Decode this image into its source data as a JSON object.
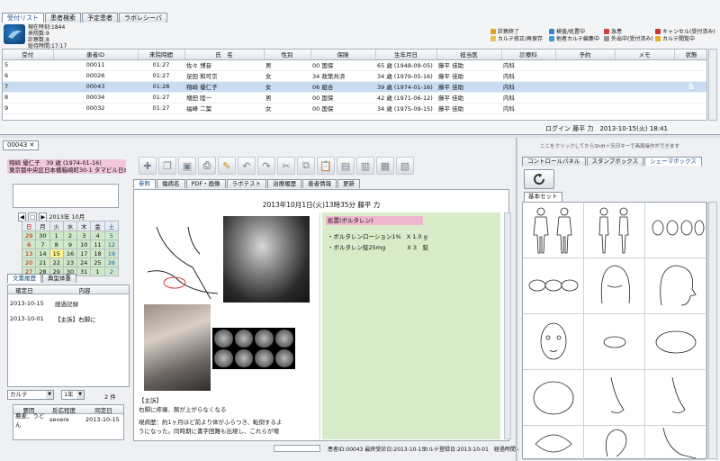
{
  "top_tabs": [
    "受付リスト",
    "患者検索",
    "予定患者",
    "ラボレシーバ"
  ],
  "counts": [
    "現在時刻:1844",
    "来院数:9",
    "診察数:8",
    "総待時間:17:17"
  ],
  "legend": [
    {
      "label": "診察終了",
      "color": "#e0a030"
    },
    {
      "label": "カルテ修正/再保存",
      "color": "#e8c24a"
    },
    {
      "label": "検査/処置中",
      "color": "#3f7fd0"
    },
    {
      "label": "他者カルテ編集中",
      "color": "#3fa0d8"
    },
    {
      "label": "急患",
      "color": "#d04040"
    },
    {
      "label": "外出中(受付済み)",
      "color": "#999999"
    },
    {
      "label": "キャンセル(受付済み)",
      "color": "#cc3333"
    },
    {
      "label": "カルテ閲覧中",
      "color": "#e6b030"
    }
  ],
  "reception_table": {
    "columns": [
      "受付",
      "患者ID",
      "来院時間",
      "氏　名",
      "性別",
      "保険",
      "生年月日",
      "担当医",
      "診療科",
      "予約",
      "メモ",
      "状態"
    ],
    "rows": [
      [
        "5",
        "00011",
        "01:27",
        "佐々 博音",
        "男",
        "00 国保",
        "65 歳 (1948-09-05)",
        "藤平 佳助",
        "内科",
        "",
        "",
        ""
      ],
      [
        "6",
        "00026",
        "01:27",
        "足田 和可京",
        "女",
        "34 政策共済",
        "34 歳 (1979-05-16)",
        "藤平 佳助",
        "内科",
        "",
        "",
        ""
      ],
      [
        "7",
        "00043",
        "01:28",
        "翔崎 優仁子",
        "女",
        "06 組合",
        "39 歳 (1974-01-16)",
        "藤平 佳助",
        "内科",
        "",
        "",
        "📄"
      ],
      [
        "8",
        "00034",
        "01:27",
        "増田 陸一",
        "男",
        "00 国保",
        "42 歳 (1971-06-12)",
        "藤平 佳助",
        "内科",
        "",
        "",
        ""
      ],
      [
        "9",
        "00032",
        "01:27",
        "福峰 二葉",
        "女",
        "00 国保",
        "34 歳 (1975-09-15)",
        "藤平 佳助",
        "内科",
        "",
        "",
        ""
      ]
    ],
    "selected_row": 2
  },
  "login_info": "ログイン 藤平 力　2013-10-15(火) 18:41",
  "karte_tab": "00043",
  "patient_card": {
    "line1": "翔崎 優仁子　39 歳 (1974-01-16)",
    "line2": "東京都中央区日本橋箱崎町30-1 タマビル日本..."
  },
  "calendar": {
    "title": "2013年 10月",
    "weekdays": [
      "日",
      "月",
      "火",
      "水",
      "木",
      "金",
      "土"
    ],
    "weeks": [
      [
        "29",
        "30",
        "1",
        "2",
        "3",
        "4",
        "5"
      ],
      [
        "6",
        "7",
        "8",
        "9",
        "10",
        "11",
        "12"
      ],
      [
        "13",
        "14",
        "15",
        "16",
        "17",
        "18",
        "19"
      ],
      [
        "20",
        "21",
        "22",
        "23",
        "24",
        "25",
        "26"
      ],
      [
        "27",
        "28",
        "29",
        "30",
        "31",
        "1",
        "2"
      ]
    ],
    "today": "15"
  },
  "doc_tabs": [
    "文書履歴",
    "典型体重"
  ],
  "doc_list": {
    "columns": [
      "確定日",
      "内容"
    ],
    "rows": [
      [
        "2013-10-15",
        "経過記録"
      ],
      [
        "2013-10-01",
        "【主訴】右脚に"
      ]
    ]
  },
  "filter": {
    "type": "カルテ",
    "period": "1年",
    "count": "2 件"
  },
  "allergy": {
    "columns": [
      "要因",
      "反応程度",
      "同定日"
    ],
    "rows": [
      [
        "蕎麦、うどん",
        "severe",
        "2013-10-15"
      ]
    ]
  },
  "toolbar_icons": [
    "new-doc-icon",
    "copy-icon",
    "save-icon",
    "print-icon",
    "edit-icon",
    "undo-icon",
    "redo-icon",
    "cut-icon",
    "copy-text-icon",
    "paste-icon",
    "doc1-icon",
    "doc2-icon",
    "doc3-icon",
    "doc4-icon"
  ],
  "sub_tabs": [
    "参照",
    "傷病名",
    "PDF・画像",
    "ラボテスト",
    "治療履歴",
    "患者情報",
    "更新"
  ],
  "karte": {
    "header": "2013年10月1日(火)13時35分 藤平 力",
    "rx_title": "処置(ボルタレン)",
    "rx_lines": [
      [
        "・ボルタレンローション1%",
        "X 1.0 g"
      ],
      [
        "・ボルタレン錠25mg",
        "X 3　錠"
      ]
    ],
    "soap": [
      "【主訴】",
      "右脚に疼痛、腕が上がらなくなる",
      "",
      "現病歴：約1ヶ月ほど前より体がふらつき、転倒するよ",
      "うになった。同時期に書字困難も出現し、これらが増"
    ]
  },
  "karte_status": {
    "patient": "患者ID:00043 最終受診日:2013-10-15",
    "info": "カルテ登録日:2013-10-01　経過時間 40 秒"
  },
  "panel": {
    "hint": "ここをクリックしてからShift＋矢印キーで画面操作ができます",
    "tabs": [
      "コントロールパネル",
      "スタンプボックス",
      "シェーマボックス"
    ],
    "basic_tab": "基本セット"
  }
}
